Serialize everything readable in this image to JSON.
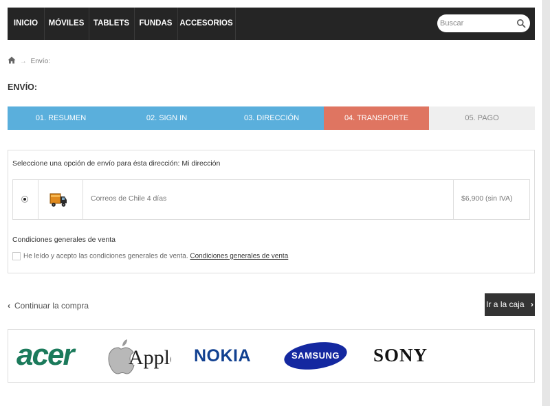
{
  "nav": {
    "items": [
      "INICIO",
      "MÓVILES",
      "TABLETS",
      "FUNDAS",
      "ACCESORIOS"
    ],
    "search_placeholder": "Buscar"
  },
  "breadcrumb": {
    "separator": "→",
    "current": "Envío:"
  },
  "page_title": "ENVÍO:",
  "steps": [
    {
      "label": "01. RESUMEN",
      "color": "#5aafdc"
    },
    {
      "label": "02. SIGN IN",
      "color": "#5aafdc"
    },
    {
      "label": "03. DIRECCIÓN",
      "color": "#5aafdc"
    },
    {
      "label": "04. TRANSPORTE",
      "color": "#df7561"
    },
    {
      "label": "05. PAGO",
      "color": "#efefef"
    }
  ],
  "shipping": {
    "title": "Seleccione una opción de envío para ésta dirección: Mi dirección",
    "option": {
      "carrier": "Correos de Chile 4 días",
      "price": "$6,900 (sin IVA)",
      "icon": "truck-icon"
    }
  },
  "terms": {
    "title": "Condiciones generales de venta",
    "text": "He leído y acepto las condiciones generales de venta.",
    "link": "Condiciones generales de venta"
  },
  "actions": {
    "continue": "Continuar la compra",
    "checkout": "Ir a la caja"
  },
  "brands": [
    "acer",
    "Apple",
    "NOKIA",
    "SAMSUNG",
    "SONY"
  ],
  "colors": {
    "nav_bg": "#252525",
    "step_blue": "#5aafdc",
    "step_active": "#df7561",
    "step_inactive": "#efefef",
    "acer": "#1b7a5b",
    "nokia": "#124191",
    "samsung": "#1428a0"
  }
}
